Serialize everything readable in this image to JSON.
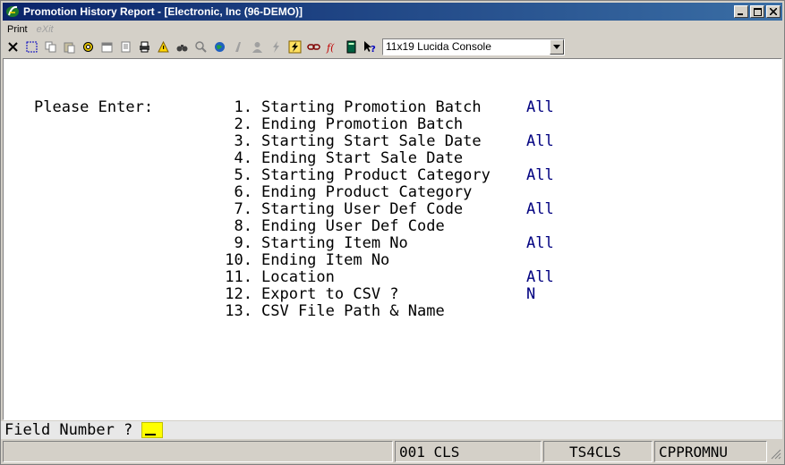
{
  "window": {
    "title": "Promotion History Report - [Electronic, Inc (96-DEMO)]"
  },
  "menu": [
    {
      "label": "Print",
      "enabled": true
    },
    {
      "label": "eXit",
      "enabled": false
    }
  ],
  "toolbar": {
    "font_select": "11x19 Lucida Console"
  },
  "form": {
    "prompt": "Please Enter:",
    "fields": [
      {
        "num": "1.",
        "label": "Starting Promotion Batch",
        "value": "All"
      },
      {
        "num": "2.",
        "label": "Ending Promotion Batch",
        "value": ""
      },
      {
        "num": "3.",
        "label": "Starting Start Sale Date",
        "value": "All"
      },
      {
        "num": "4.",
        "label": "Ending Start Sale Date",
        "value": ""
      },
      {
        "num": "5.",
        "label": "Starting Product Category",
        "value": "All"
      },
      {
        "num": "6.",
        "label": "Ending Product Category",
        "value": ""
      },
      {
        "num": "7.",
        "label": "Starting User Def Code",
        "value": "All"
      },
      {
        "num": "8.",
        "label": "Ending User Def Code",
        "value": ""
      },
      {
        "num": "9.",
        "label": "Starting Item No",
        "value": "All"
      },
      {
        "num": "10.",
        "label": "Ending Item No",
        "value": ""
      },
      {
        "num": "11.",
        "label": "Location",
        "value": "All"
      },
      {
        "num": "12.",
        "label": "Export to CSV ?",
        "value": "N"
      },
      {
        "num": "13.",
        "label": "CSV File Path & Name",
        "value": ""
      }
    ],
    "field_number_prompt": "Field Number ?"
  },
  "status": {
    "session": "001 CLS",
    "terminal": "TS4CLS",
    "program": "CPPROMNU"
  }
}
